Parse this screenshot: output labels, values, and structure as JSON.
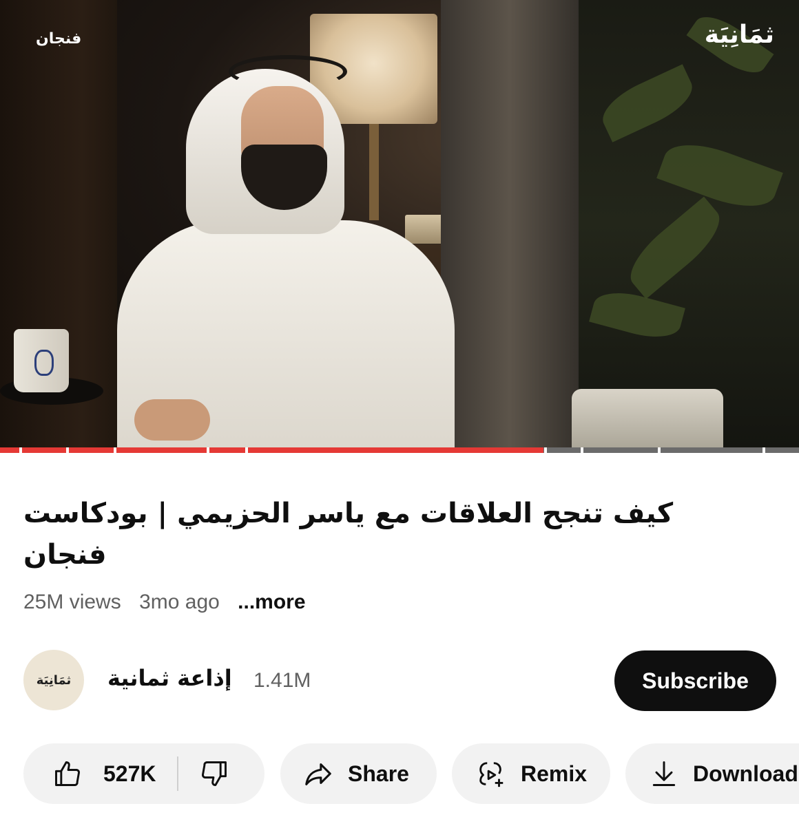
{
  "player": {
    "logo_text": "ثمَانِيَة",
    "show_name": "فنجان",
    "progress_fraction": 0.68,
    "accent_color": "#e53935"
  },
  "video": {
    "title": "كيف تنجح العلاقات مع ياسر الحزيمي | بودكاست فنجان",
    "views": "25M views",
    "age": "3mo ago",
    "more_label": "...more"
  },
  "channel": {
    "avatar_text": "ثمَانِيَة",
    "name": "إذاعة ثمانية",
    "subscribers": "1.41M",
    "subscribe_label": "Subscribe"
  },
  "actions": {
    "like_count": "527K",
    "share_label": "Share",
    "remix_label": "Remix",
    "download_label": "Download",
    "icons": [
      "thumb-up-icon",
      "thumb-down-icon",
      "share-arrow-icon",
      "remix-icon",
      "download-icon"
    ]
  }
}
